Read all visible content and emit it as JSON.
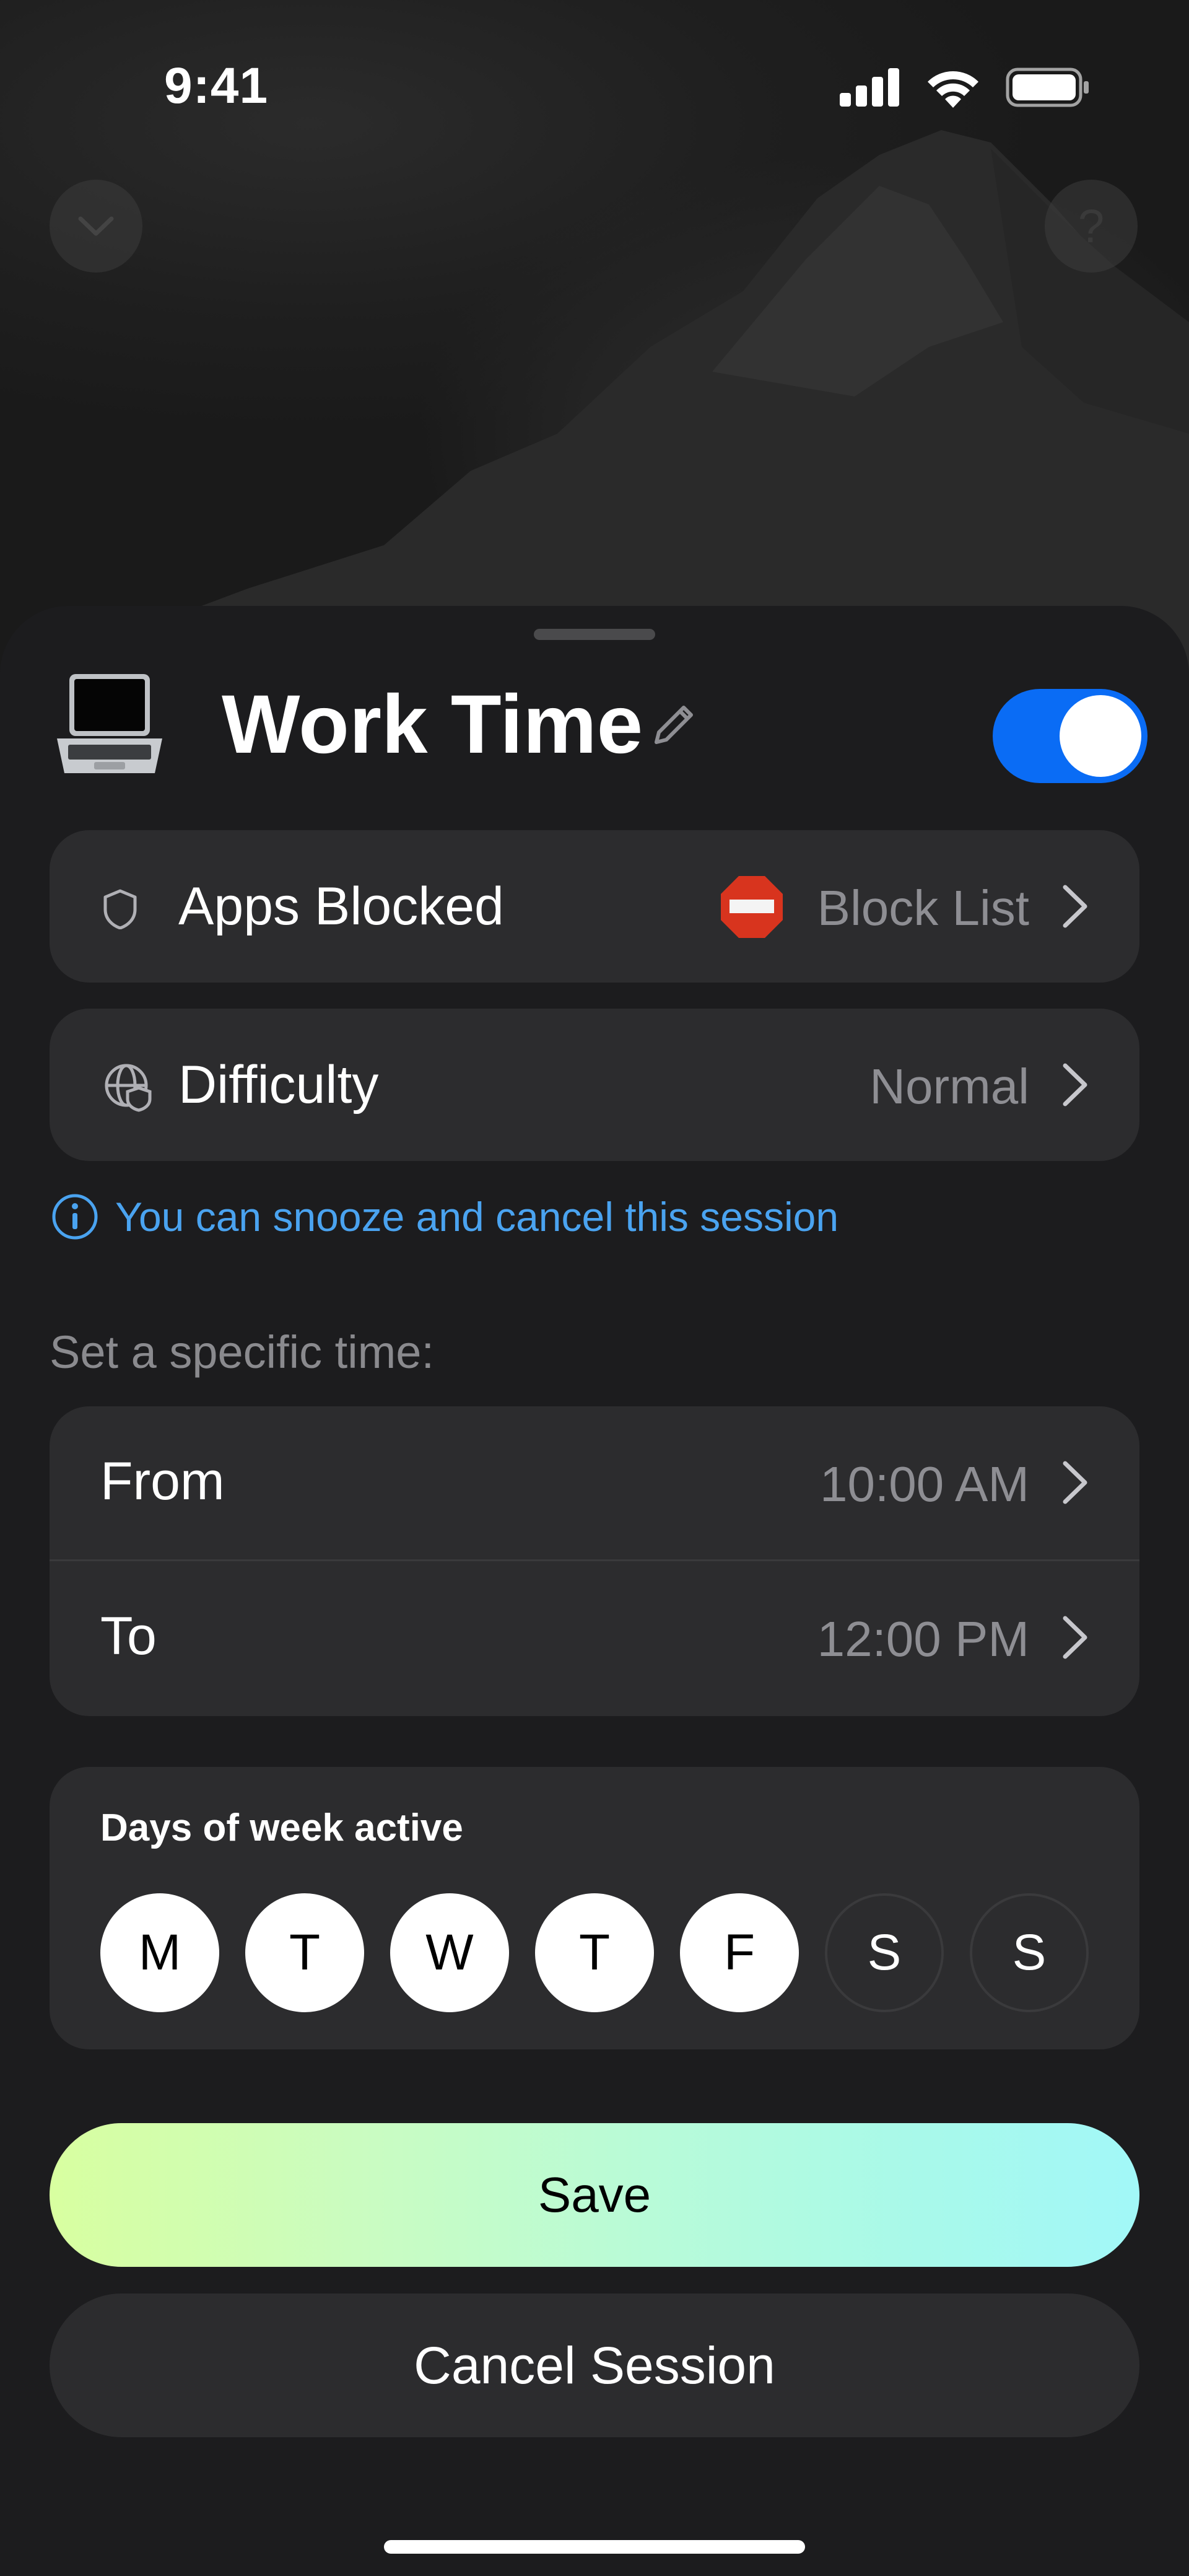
{
  "status_bar": {
    "time": "9:41"
  },
  "sheet": {
    "title": "Work Time",
    "enabled": true,
    "apps_blocked": {
      "label": "Apps Blocked",
      "value": "Block List"
    },
    "difficulty": {
      "label": "Difficulty",
      "value": "Normal"
    },
    "info_text": "You can snooze and cancel this session",
    "schedule_title": "Set a specific time:",
    "from": {
      "label": "From",
      "value": "10:00 AM"
    },
    "to": {
      "label": "To",
      "value": "12:00 PM"
    },
    "days": {
      "title": "Days of week active",
      "items": [
        {
          "label": "M",
          "active": true
        },
        {
          "label": "T",
          "active": true
        },
        {
          "label": "W",
          "active": true
        },
        {
          "label": "T",
          "active": true
        },
        {
          "label": "F",
          "active": true
        },
        {
          "label": "S",
          "active": false
        },
        {
          "label": "S",
          "active": false
        }
      ]
    },
    "save_label": "Save",
    "cancel_label": "Cancel Session"
  },
  "icons": {
    "collapse": "chevron-down-icon",
    "help": "question-mark-icon",
    "session": "laptop-icon",
    "edit": "pencil-icon",
    "apps": "shield-icon",
    "difficulty": "globe-shield-icon",
    "block_list": "stop-sign-icon",
    "info": "info-icon"
  },
  "colors": {
    "accent": "#0a6cf5",
    "info": "#4aa3f0",
    "card": "#2c2c2e"
  }
}
